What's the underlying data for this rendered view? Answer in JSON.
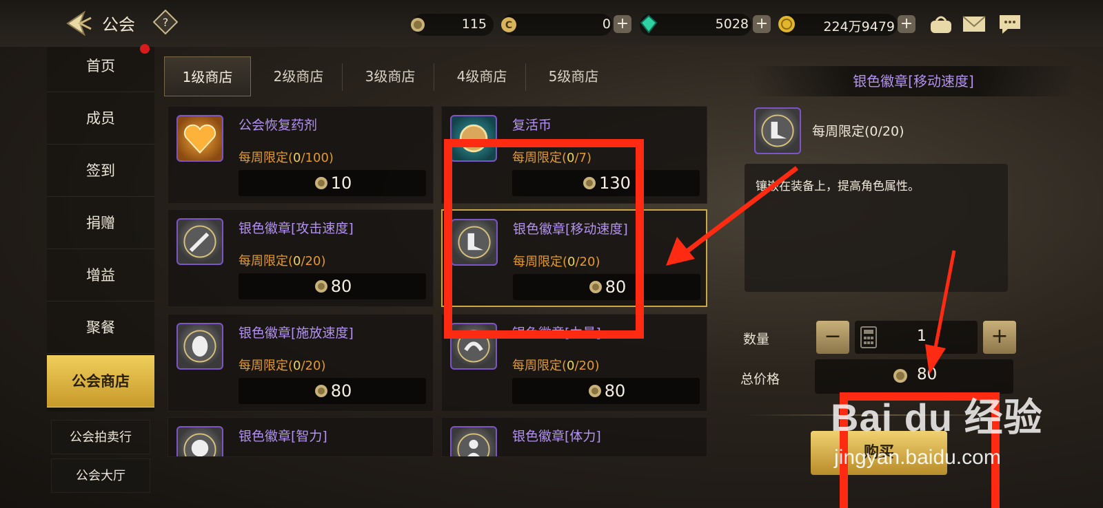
{
  "header": {
    "title": "公会",
    "currencies": [
      {
        "icon": "guild-coin-icon",
        "value": "115"
      },
      {
        "icon": "c-coin-icon",
        "value": "0"
      },
      {
        "icon": "green-gem-icon",
        "value": "5028"
      },
      {
        "icon": "gold-coin-icon",
        "value": "224万9479"
      }
    ]
  },
  "sidebar": {
    "items": [
      {
        "label": "首页"
      },
      {
        "label": "成员"
      },
      {
        "label": "签到"
      },
      {
        "label": "捐赠"
      },
      {
        "label": "增益"
      },
      {
        "label": "聚餐"
      },
      {
        "label": "公会商店"
      }
    ],
    "extra": [
      {
        "label": "公会拍卖行"
      },
      {
        "label": "公会大厅"
      }
    ]
  },
  "tabs": [
    "1级商店",
    "2级商店",
    "3级商店",
    "4级商店",
    "5级商店"
  ],
  "items": [
    {
      "name": "公会恢复药剂",
      "limit_prefix": "每周限定(",
      "limit_used": "0",
      "limit_total": "/100)",
      "price": "10"
    },
    {
      "name": "复活币",
      "limit_prefix": "每周限定(",
      "limit_used": "0",
      "limit_total": "/7)",
      "price": "130"
    },
    {
      "name": "银色徽章[攻击速度]",
      "limit_prefix": "每周限定(",
      "limit_used": "0",
      "limit_total": "/20)",
      "price": "80"
    },
    {
      "name": "银色徽章[移动速度]",
      "limit_prefix": "每周限定(",
      "limit_used": "0",
      "limit_total": "/20)",
      "price": "80"
    },
    {
      "name": "银色徽章[施放速度]",
      "limit_prefix": "每周限定(",
      "limit_used": "0",
      "limit_total": "/20)",
      "price": "80"
    },
    {
      "name": "银色徽章[力量]",
      "limit_prefix": "每周限定(",
      "limit_used": "0",
      "limit_total": "/20)",
      "price": "80"
    },
    {
      "name": "银色徽章[智力]"
    },
    {
      "name": "银色徽章[体力]"
    }
  ],
  "detail": {
    "title": "银色徽章[移动速度]",
    "limit": "每周限定(0/20)",
    "description": "镶嵌在装备上，提高角色属性。",
    "quantity_label": "数量",
    "quantity": "1",
    "total_label": "总价格",
    "total": "80",
    "buy_label": "购买"
  },
  "watermark": {
    "brand": "Bai du 经验",
    "url": "jingyan.baidu.com"
  },
  "colors": {
    "accent_gold": "#f0ce5c",
    "item_purple": "#b493f0",
    "limit_orange": "#e59a2b",
    "annotation_red": "#ff2a12"
  }
}
